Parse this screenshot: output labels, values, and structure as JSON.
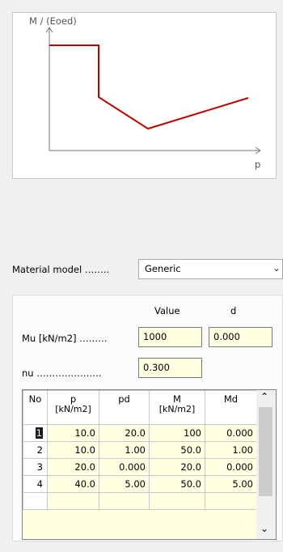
{
  "chart": {
    "y_axis_label": "M / (Eoed)",
    "x_axis_label": "p"
  },
  "material": {
    "label": "Material model ……..",
    "selected": "Generic"
  },
  "params": {
    "col_value": "Value",
    "col_d": "d",
    "mu_label": "Mu [kN/m2] ………",
    "mu_value": "1000",
    "mu_d": "0.000",
    "nu_label": "nu …………………",
    "nu_value": "0.300"
  },
  "table": {
    "headers": [
      {
        "main": "No",
        "unit": ""
      },
      {
        "main": "p",
        "unit": "[kN/m2]"
      },
      {
        "main": "pd",
        "unit": ""
      },
      {
        "main": "M",
        "unit": "[kN/m2]"
      },
      {
        "main": "Md",
        "unit": ""
      }
    ],
    "rows": [
      [
        "1",
        "10.0",
        "20.0",
        "100",
        "0.000"
      ],
      [
        "2",
        "10.0",
        "1.00",
        "50.0",
        "1.00"
      ],
      [
        "3",
        "20.0",
        "0.000",
        "20.0",
        "0.000"
      ],
      [
        "4",
        "40.0",
        "5.00",
        "50.0",
        "5.00"
      ]
    ]
  },
  "icons": {
    "scroll_up": "chevron-up-icon",
    "scroll_down": "chevron-down-icon",
    "combo": "chevron-down-icon"
  },
  "colors": {
    "curve": "#c00000",
    "input_bg": "#ffffe1"
  }
}
